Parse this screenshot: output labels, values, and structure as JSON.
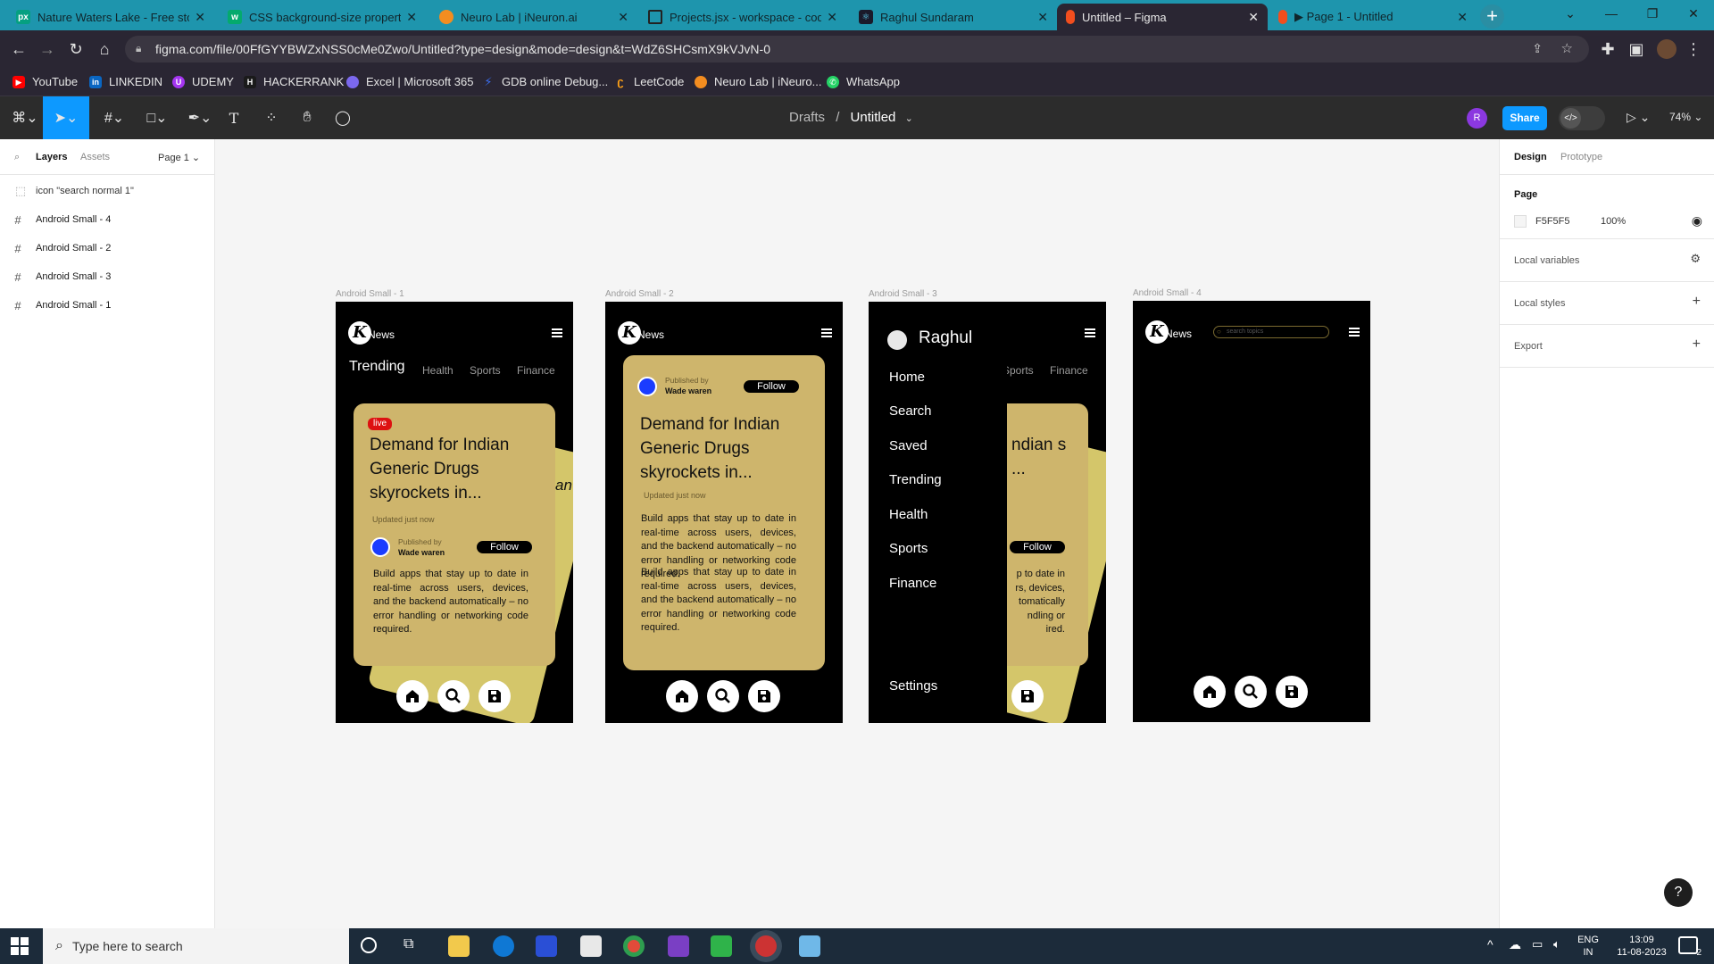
{
  "browser": {
    "tabs": [
      {
        "label": "Nature Waters Lake - Free stock",
        "icon": "pexels-icon",
        "color": "#05a081"
      },
      {
        "label": "CSS background-size property",
        "icon": "w3schools-icon",
        "color": "#04aa6d"
      },
      {
        "label": "Neuro Lab | iNeuron.ai",
        "icon": "ineuron-icon",
        "color": "#f38d20"
      },
      {
        "label": "Projects.jsx - workspace - code-",
        "icon": "codesandbox-icon",
        "color": "#222222"
      },
      {
        "label": "Raghul Sundaram",
        "icon": "react-icon",
        "color": "#222222"
      },
      {
        "label": "Untitled – Figma",
        "icon": "figma-icon",
        "color": "#f24e1e",
        "active": true
      },
      {
        "label": "▶ Page 1 - Untitled",
        "icon": "figma-icon",
        "color": "#f24e1e"
      }
    ],
    "url": "figma.com/file/00FfGYYBWZxNSS0cMe0Zwo/Untitled?type=design&mode=design&t=WdZ6SHCsmX9kVJvN-0",
    "bookmarks": [
      {
        "label": "YouTube",
        "color": "#ff0000"
      },
      {
        "label": "LINKEDIN",
        "color": "#0a66c2"
      },
      {
        "label": "UDEMY",
        "color": "#a435f0"
      },
      {
        "label": "HACKERRANK",
        "color": "#1ba94c"
      },
      {
        "label": "Excel | Microsoft 365",
        "color": "#7b68ee"
      },
      {
        "label": "GDB online Debug...",
        "color": "#3a6df0"
      },
      {
        "label": "LeetCode",
        "color": "#ffa116"
      },
      {
        "label": "Neuro Lab | iNeuro...",
        "color": "#f38d20"
      },
      {
        "label": "WhatsApp",
        "color": "#25d366"
      }
    ]
  },
  "figma": {
    "breadcrumb_parent": "Drafts",
    "breadcrumb_sep": "/",
    "file_name": "Untitled",
    "avatar_initial": "R",
    "share_label": "Share",
    "zoom": "74%",
    "left_panel": {
      "tab_layers": "Layers",
      "tab_assets": "Assets",
      "page_selector": "Page 1",
      "layers": [
        {
          "label": "icon \"search normal 1\"",
          "type": "component"
        },
        {
          "label": "Android Small - 4",
          "type": "frame"
        },
        {
          "label": "Android Small - 2",
          "type": "frame"
        },
        {
          "label": "Android Small - 3",
          "type": "frame"
        },
        {
          "label": "Android Small - 1",
          "type": "frame"
        }
      ]
    },
    "right_panel": {
      "tab_design": "Design",
      "tab_prototype": "Prototype",
      "page_heading": "Page",
      "page_color": "F5F5F5",
      "page_opacity": "100%",
      "sections": [
        "Local variables",
        "Local styles",
        "Export"
      ]
    },
    "canvas": {
      "frames": [
        {
          "label": "Android Small - 1",
          "brand": "News",
          "categories": [
            "Trending",
            "Health",
            "Sports",
            "Finance"
          ],
          "live": "live",
          "headline": "Demand for Indian Generic Drugs skyrockets in...",
          "updated": "Updated just now",
          "published_by": "Published by",
          "author": "Wade waren",
          "follow": "Follow",
          "body": "Build apps that stay up to date in real-time across users, devices, and the backend automatically – no error handling or networking code required."
        },
        {
          "label": "Android Small - 2",
          "brand": "News",
          "published_by": "Published by",
          "author": "Wade waren",
          "follow": "Follow",
          "headline": "Demand for Indian Generic Drugs skyrockets in...",
          "updated": "Updated just now",
          "body": "Build apps that stay up to date in real-time across users, devices, and the backend automatically – no error handling or networking code required.",
          "body2": "Build apps that stay up to date in real-time across users, devices, and the backend automatically – no error handling or networking code required."
        },
        {
          "label": "Android Small - 3",
          "user": "Raghul",
          "menu": [
            "Home",
            "Search",
            "Saved",
            "Trending",
            "Health",
            "Sports",
            "Finance"
          ],
          "settings": "Settings",
          "bg_categories": [
            "Sports",
            "Finance"
          ],
          "bg_headline": "ndian s ...",
          "bg_follow": "Follow",
          "bg_body": "p to date in rs, devices, tomatically ndling or ired."
        },
        {
          "label": "Android Small - 4",
          "brand": "News",
          "search_placeholder": "search topics"
        }
      ]
    }
  },
  "taskbar": {
    "search_placeholder": "Type here to search",
    "lang_top": "ENG",
    "lang_bottom": "IN",
    "time": "13:09",
    "date": "11-08-2023",
    "notifications": "2"
  }
}
